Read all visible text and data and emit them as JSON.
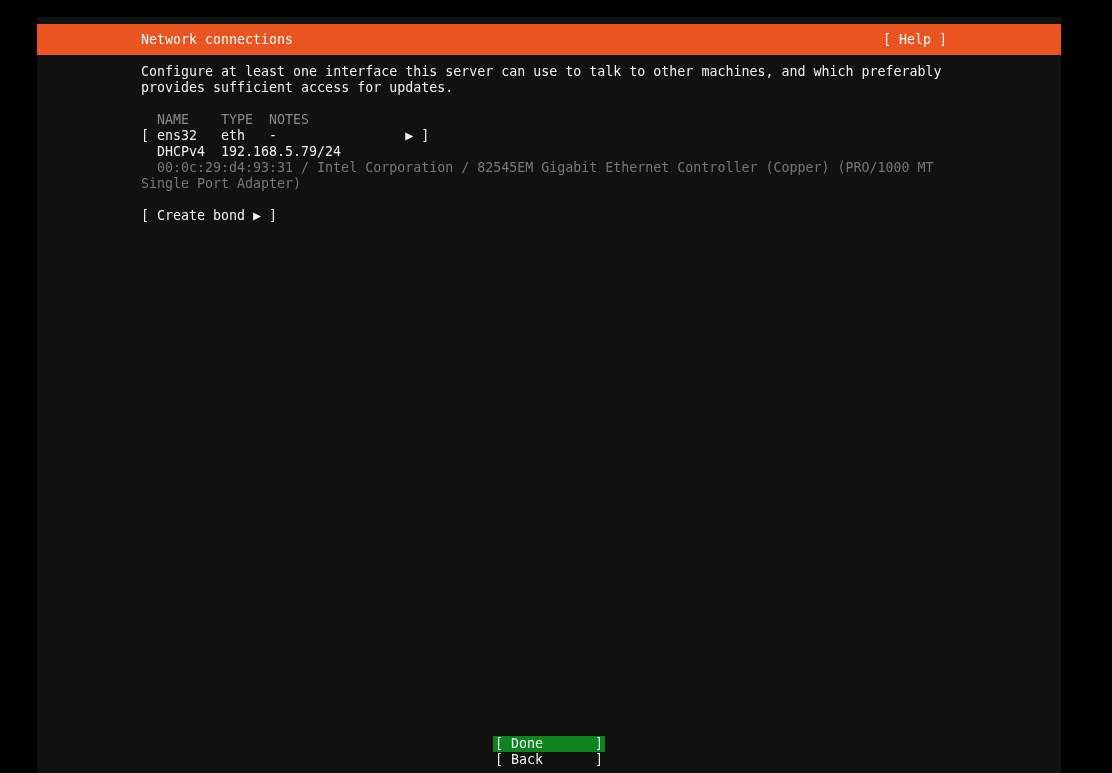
{
  "header": {
    "title": "Network connections",
    "help": "[ Help ]"
  },
  "intro": "Configure at least one interface this server can use to talk to other machines, and which preferably provides sufficient access for updates.",
  "table": {
    "columns": [
      "NAME",
      "TYPE",
      "NOTES"
    ],
    "rows": [
      {
        "bracket_open": "[",
        "name": "ens32",
        "type": "eth",
        "notes": "-",
        "arrow": "▶",
        "bracket_close": "]",
        "selected": false,
        "address_kind": "DHCPv4",
        "address": "192.168.5.79/24",
        "info": "00:0c:29:d4:93:31 / Intel Corporation / 82545EM Gigabit Ethernet Controller (Copper) (PRO/1000 MT Single Port Adapter)"
      }
    ]
  },
  "create_bond": "[ Create bond ▶ ]",
  "buttons": [
    {
      "bracket_open": "[",
      "label": "Done",
      "bracket_close": "]",
      "selected": true
    },
    {
      "bracket_open": "[",
      "label": "Back",
      "bracket_close": "]",
      "selected": false
    }
  ]
}
